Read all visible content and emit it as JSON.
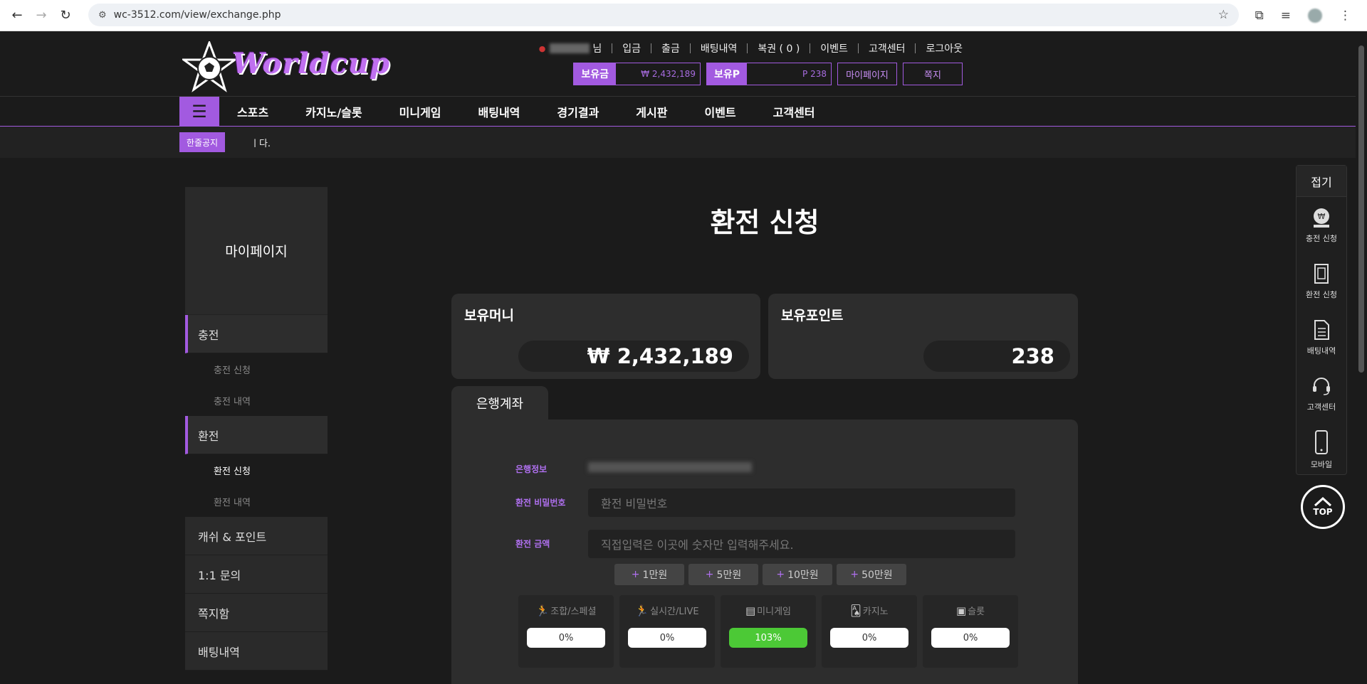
{
  "browser": {
    "url": "wc-3512.com/view/exchange.php"
  },
  "header": {
    "logo_text": "Worldcup",
    "user_suffix": "님",
    "links": [
      "입금",
      "출금",
      "배팅내역",
      "복권 ( 0 )",
      "이벤트",
      "고객센터",
      "로그아웃"
    ],
    "money_label": "보유금",
    "money_value": "₩ 2,432,189",
    "point_label": "보유P",
    "point_value": "P 238",
    "mypage_btn": "마이페이지",
    "note_btn": "쪽지"
  },
  "nav": {
    "items": [
      "스포츠",
      "카지노/슬롯",
      "미니게임",
      "배팅내역",
      "경기결과",
      "게시판",
      "이벤트",
      "고객센터"
    ]
  },
  "notice": {
    "badge": "한줄공지",
    "text": "ㅣ다."
  },
  "sidebar": {
    "title": "마이페이지",
    "charge": "충전",
    "charge_apply": "충전 신청",
    "charge_history": "충전 내역",
    "exchange": "환전",
    "exchange_apply": "환전 신청",
    "exchange_history": "환전 내역",
    "cash_point": "캐쉬 & 포인트",
    "inquiry": "1:1 문의",
    "inbox": "쪽지함",
    "bet_history": "배팅내역"
  },
  "main": {
    "title": "환전 신청",
    "money_title": "보유머니",
    "money_value": "₩ 2,432,189",
    "point_title": "보유포인트",
    "point_value": "238",
    "tab_bank": "은행계좌",
    "bank_info_label": "은행정보",
    "password_label": "환전 비밀번호",
    "password_placeholder": "환전 비밀번호",
    "amount_label": "환전 금액",
    "amount_placeholder": "직접입력은 이곳에 숫자만 입력해주세요.",
    "amount_buttons": [
      "1만원",
      "5만원",
      "10만원",
      "50만원"
    ],
    "rolling": [
      {
        "label": "조합/스페셜",
        "value": "0%"
      },
      {
        "label": "실시간/LIVE",
        "value": "0%"
      },
      {
        "label": "미니게임",
        "value": "103%"
      },
      {
        "label": "카지노",
        "value": "0%"
      },
      {
        "label": "슬롯",
        "value": "0%"
      }
    ]
  },
  "quick_menu": {
    "fold": "접기",
    "items": [
      "충전 신청",
      "환전 신청",
      "배팅내역",
      "고객센터",
      "모바일"
    ],
    "top": "TOP"
  },
  "colors": {
    "accent": "#a25ae0",
    "success": "#4cc936"
  }
}
